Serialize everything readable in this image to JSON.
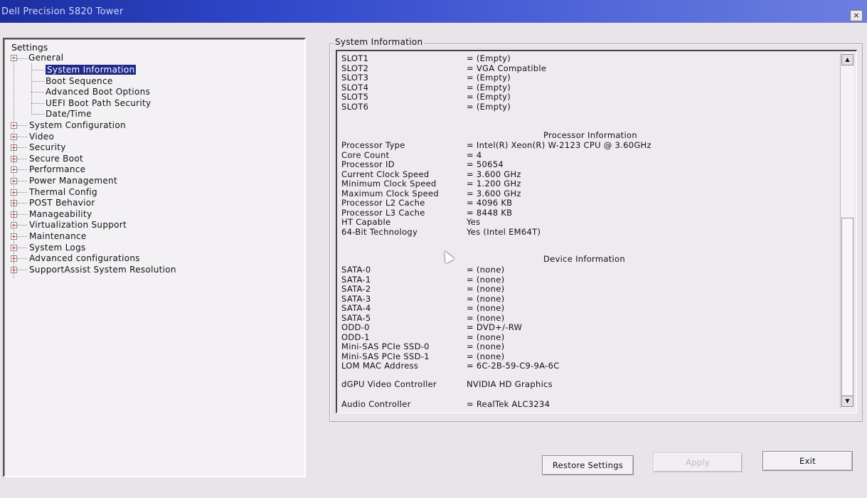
{
  "window": {
    "title": "Dell Precision 5820 Tower",
    "close_label": "×"
  },
  "tree": {
    "root_label": "Settings",
    "general": {
      "label": "General",
      "children": [
        "System Information",
        "Boot Sequence",
        "Advanced Boot Options",
        "UEFI Boot Path Security",
        "Date/Time"
      ]
    },
    "nodes": [
      "System Configuration",
      "Video",
      "Security",
      "Secure Boot",
      "Performance",
      "Power Management",
      "Thermal Config",
      "POST Behavior",
      "Manageability",
      "Virtualization Support",
      "Maintenance",
      "System Logs",
      "Advanced configurations",
      "SupportAssist System Resolution"
    ]
  },
  "info": {
    "group_title": "System Information",
    "slots": [
      {
        "label": "SLOT1",
        "value": "= (Empty)"
      },
      {
        "label": "SLOT2",
        "value": "= VGA Compatible"
      },
      {
        "label": "SLOT3",
        "value": "= (Empty)"
      },
      {
        "label": "SLOT4",
        "value": "= (Empty)"
      },
      {
        "label": "SLOT5",
        "value": "= (Empty)"
      },
      {
        "label": "SLOT6",
        "value": "= (Empty)"
      }
    ],
    "processor_heading": "Processor Information",
    "processor": [
      {
        "label": "Processor Type",
        "value": "= Intel(R) Xeon(R) W-2123 CPU @ 3.60GHz"
      },
      {
        "label": "Core Count",
        "value": "= 4"
      },
      {
        "label": "Processor ID",
        "value": "= 50654"
      },
      {
        "label": "Current Clock Speed",
        "value": "= 3.600 GHz"
      },
      {
        "label": "Minimum Clock Speed",
        "value": "= 1.200 GHz"
      },
      {
        "label": "Maximum Clock Speed",
        "value": "= 3.600 GHz"
      },
      {
        "label": "Processor L2 Cache",
        "value": "= 4096 KB"
      },
      {
        "label": "Processor L3 Cache",
        "value": "= 8448 KB"
      },
      {
        "label": "HT Capable",
        "value": "Yes"
      },
      {
        "label": "64-Bit Technology",
        "value": "Yes (Intel EM64T)"
      }
    ],
    "device_heading": "Device Information",
    "devices": [
      {
        "label": "SATA-0",
        "value": "= (none)"
      },
      {
        "label": "SATA-1",
        "value": "= (none)"
      },
      {
        "label": "SATA-2",
        "value": "= (none)"
      },
      {
        "label": "SATA-3",
        "value": "= (none)"
      },
      {
        "label": "SATA-4",
        "value": "= (none)"
      },
      {
        "label": "SATA-5",
        "value": "= (none)"
      },
      {
        "label": "ODD-0",
        "value": "= DVD+/-RW"
      },
      {
        "label": "ODD-1",
        "value": "= (none)"
      },
      {
        "label": "Mini-SAS PCIe SSD-0",
        "value": "= (none)"
      },
      {
        "label": "Mini-SAS PCIe SSD-1",
        "value": "= (none)"
      },
      {
        "label": "LOM MAC Address",
        "value": "= 6C-2B-59-C9-9A-6C"
      }
    ],
    "dgpu": {
      "label": "dGPU Video Controller",
      "value": "NVIDIA HD Graphics"
    },
    "audio": {
      "label": "Audio Controller",
      "value": "= RealTek ALC3234"
    }
  },
  "buttons": {
    "restore": "Restore Settings",
    "apply": "Apply",
    "exit": "Exit"
  }
}
